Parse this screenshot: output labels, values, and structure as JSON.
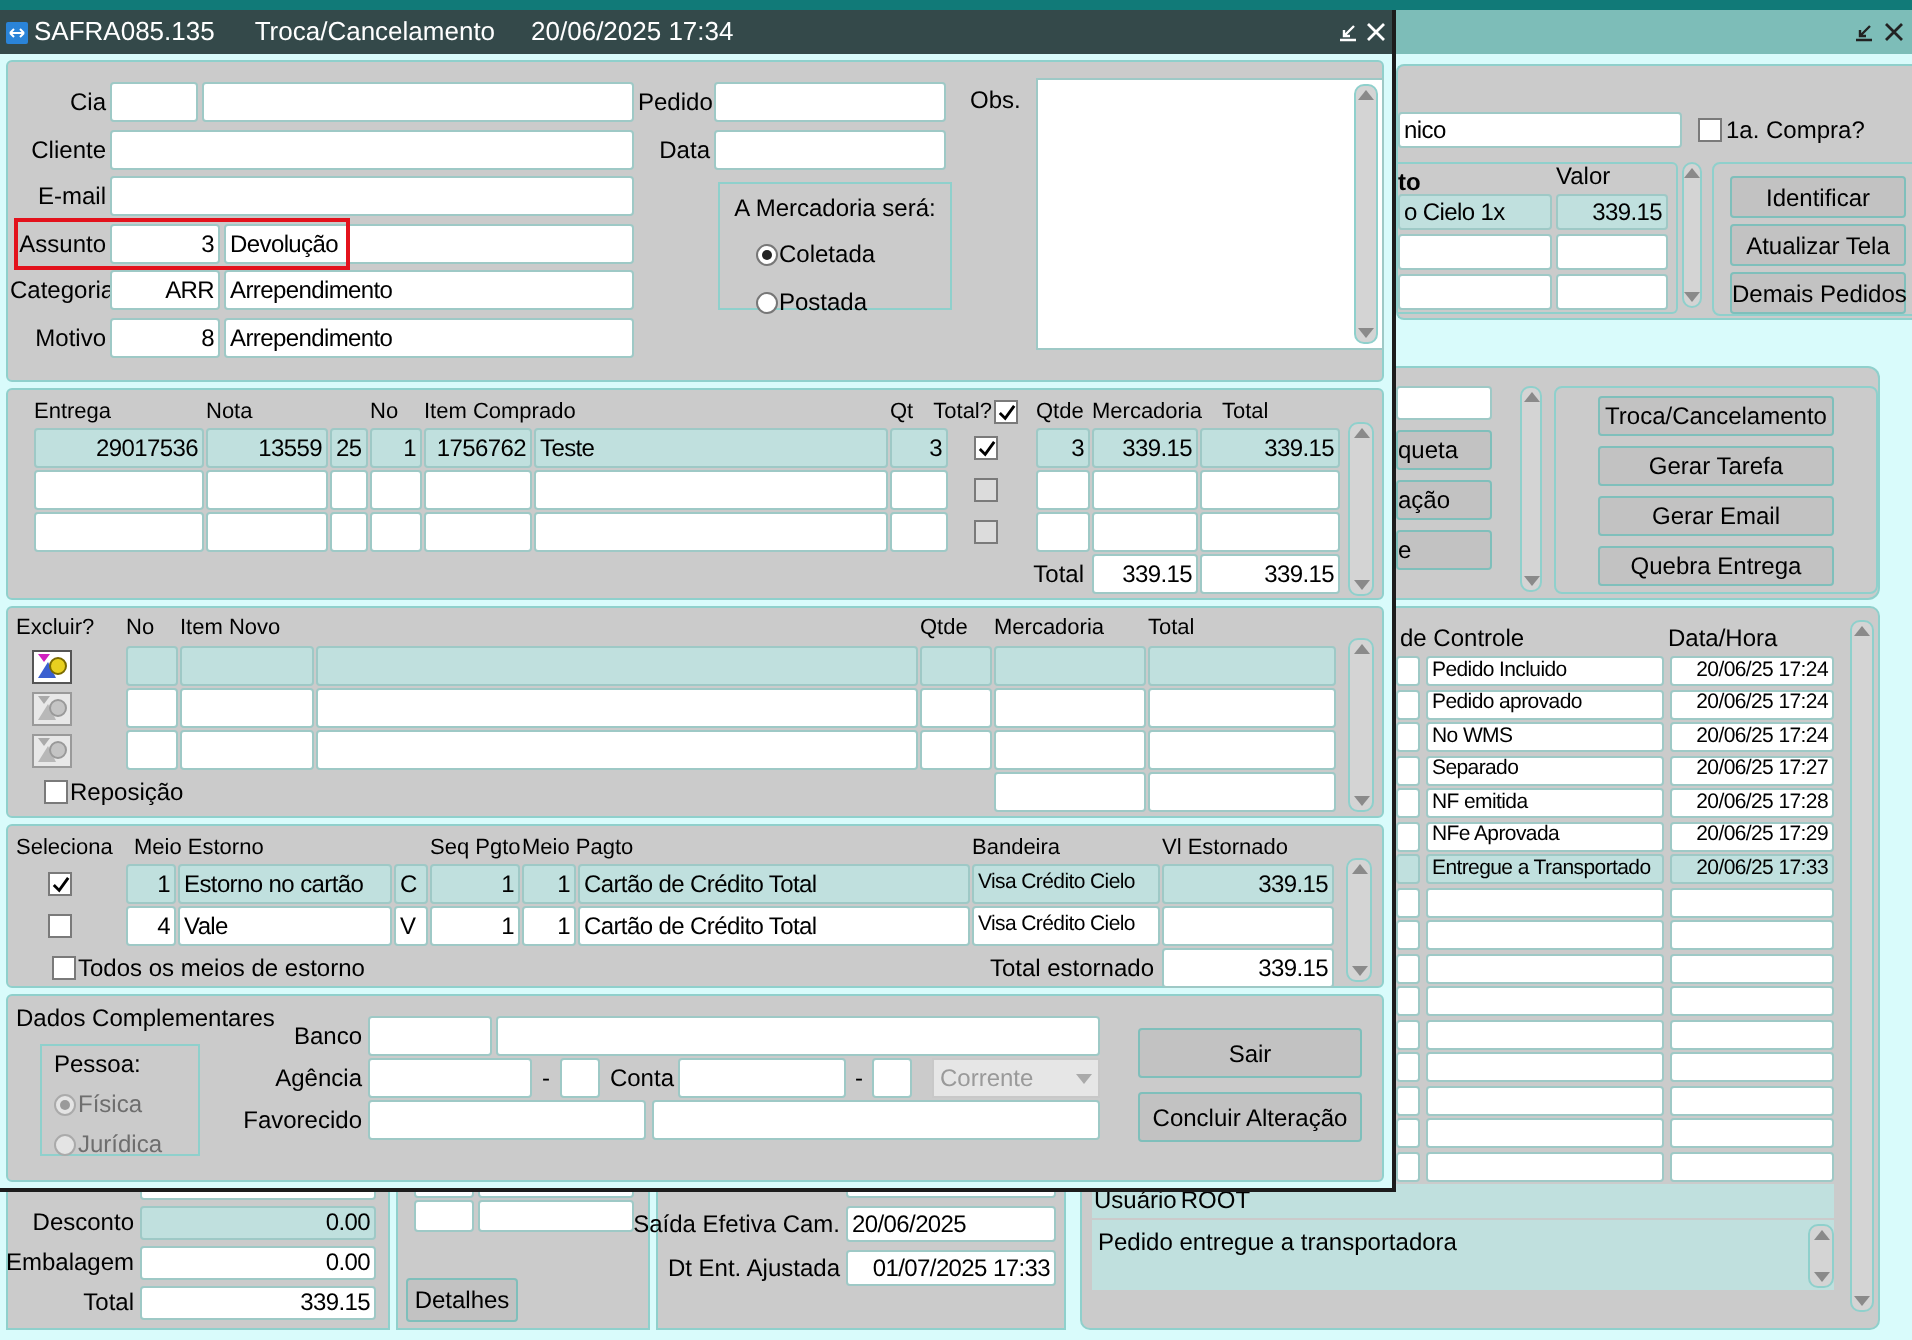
{
  "background_window": {
    "customer_field": "nico",
    "first_purchase": {
      "label": "1a. Compra?",
      "checked": false
    },
    "payment_group": {
      "title": "to",
      "columns": [
        "Valor"
      ],
      "rows": [
        {
          "selected": true,
          "cells": [
            "o Cielo 1x",
            "339.15"
          ]
        },
        {
          "selected": false,
          "cells": []
        },
        {
          "selected": false,
          "cells": []
        }
      ]
    },
    "top_buttons": [
      "Identificar",
      "Atualizar Tela",
      "Demais Pedidos"
    ],
    "partial_buttons": [
      "queta",
      "ação",
      "e"
    ],
    "action_buttons": [
      "Troca/Cancelamento",
      "Gerar Tarefa",
      "Gerar Email",
      "Quebra Entrega"
    ],
    "history": {
      "columns": [
        "de Controle",
        "Data/Hora"
      ],
      "rows": [
        {
          "selected": false,
          "status": "Pedido Incluido",
          "datetime": "20/06/25 17:24"
        },
        {
          "selected": false,
          "status": "Pedido aprovado",
          "datetime": "20/06/25 17:24"
        },
        {
          "selected": false,
          "status": "No WMS",
          "datetime": "20/06/25 17:24"
        },
        {
          "selected": false,
          "status": "Separado",
          "datetime": "20/06/25 17:27"
        },
        {
          "selected": false,
          "status": "NF emitida",
          "datetime": "20/06/25 17:28"
        },
        {
          "selected": false,
          "status": "NFe Aprovada",
          "datetime": "20/06/25 17:29"
        },
        {
          "selected": true,
          "status": "Entregue a Transportado",
          "datetime": "20/06/25 17:33"
        },
        {
          "selected": false
        },
        {
          "selected": false
        },
        {
          "selected": false
        },
        {
          "selected": false
        },
        {
          "selected": false
        },
        {
          "selected": false
        },
        {
          "selected": false
        },
        {
          "selected": false
        },
        {
          "selected": false
        }
      ]
    },
    "user": {
      "label": "Usuário",
      "value": "ROOT"
    },
    "note": "Pedido entregue a transportadora",
    "amounts": [
      {
        "label": "Desconto",
        "value": "0.00",
        "selected": true
      },
      {
        "label": "Embalagem",
        "value": "0.00",
        "selected": false
      },
      {
        "label": "Total",
        "value": "339.15",
        "selected": false
      }
    ],
    "details_button": "Detalhes",
    "dates": [
      {
        "label": "Saída Efetiva Cam.",
        "value": "20/06/2025"
      },
      {
        "label": "Dt Ent. Ajustada",
        "value": "01/07/2025 17:33"
      }
    ]
  },
  "dialog": {
    "code": "SAFRA085.135",
    "title": "Troca/Cancelamento",
    "datetime": "20/06/2025 17:34",
    "header": {
      "cia_label": "Cia",
      "cliente_label": "Cliente",
      "email_label": "E-mail",
      "assunto": {
        "label": "Assunto",
        "code": "3",
        "description": "Devolução",
        "highlighted": true
      },
      "categoria": {
        "label": "Categoria",
        "code": "ARR",
        "description": "Arrependimento"
      },
      "motivo": {
        "label": "Motivo",
        "code": "8",
        "description": "Arrependimento"
      },
      "pedido_label": "Pedido",
      "data_label": "Data",
      "mercadoria": {
        "title": "A Mercadoria será:",
        "options": [
          {
            "label": "Coletada",
            "selected": true
          },
          {
            "label": "Postada",
            "selected": false
          }
        ]
      },
      "obs_label": "Obs."
    },
    "purchased": {
      "columns": [
        "Entrega",
        "Nota",
        "",
        "No",
        "Item Comprado",
        "",
        "Qt",
        "Qtde",
        "Mercadoria",
        "Total"
      ],
      "total_header": "Total?",
      "all_checked": true,
      "rows": [
        {
          "selected": true,
          "checked": true,
          "cells": [
            "29017536",
            "13559",
            "25",
            "1",
            "1756762",
            "Teste",
            "3",
            "3",
            "339.15",
            "339.15"
          ]
        },
        {
          "selected": false,
          "checked": false,
          "cells": []
        },
        {
          "selected": false,
          "checked": false,
          "cells": []
        }
      ],
      "total_label": "Total",
      "total_mercadoria": "339.15",
      "total": "339.15"
    },
    "new_items": {
      "columns": [
        "Excluir?",
        "No",
        "Item Novo",
        "Qtde",
        "Mercadoria",
        "Total"
      ],
      "rows": [
        {
          "selected": true,
          "disabled": false
        },
        {
          "selected": false,
          "disabled": true
        },
        {
          "selected": false,
          "disabled": true
        }
      ],
      "reposicao": {
        "label": "Reposição",
        "checked": false
      }
    },
    "refunds": {
      "select_header": "Seleciona",
      "columns": [
        "Meio Estorno",
        "",
        "",
        "Seq Pgto",
        "Meio Pagto",
        "",
        "Bandeira",
        "Vl Estornado"
      ],
      "rows": [
        {
          "checked": true,
          "selected": true,
          "cells": [
            "1",
            "Estorno no cartão",
            "C",
            "1",
            "1",
            "Cartão de Crédito Total",
            "Visa Crédito Cielo",
            "339.15"
          ]
        },
        {
          "checked": false,
          "selected": false,
          "cells": [
            "4",
            "Vale",
            "V",
            "1",
            "1",
            "Cartão de Crédito Total",
            "Visa Crédito Cielo"
          ]
        }
      ],
      "all_methods": {
        "label": "Todos os meios de estorno",
        "checked": false
      },
      "total_label": "Total estornado",
      "total": "339.15"
    },
    "complement": {
      "title": "Dados Complementares",
      "pessoa": {
        "title": "Pessoa:",
        "disabled": true,
        "options": [
          {
            "label": "Física",
            "selected": true
          },
          {
            "label": "Jurídica",
            "selected": false
          }
        ]
      },
      "banco_label": "Banco",
      "agencia_label": "Agência",
      "agencia_separator": "-",
      "conta_label": "Conta",
      "conta_separator": "-",
      "account_type": {
        "value": "Corrente",
        "disabled": true
      },
      "favorecido_label": "Favorecido"
    },
    "buttons": [
      "Sair",
      "Concluir Alteração"
    ]
  }
}
